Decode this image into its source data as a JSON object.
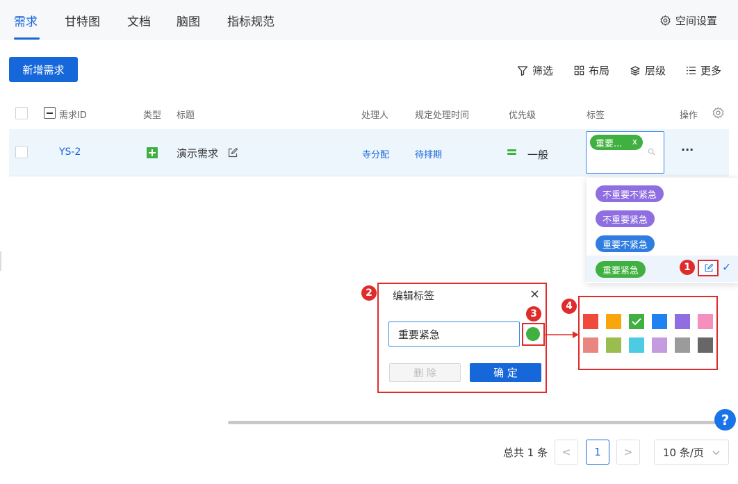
{
  "nav": {
    "tabs": [
      "需求",
      "甘特图",
      "文档",
      "脑图",
      "指标规范"
    ],
    "settings_label": "空间设置",
    "settings_icon": "gear-icon"
  },
  "toolbar": {
    "add_label": "新增需求",
    "filter_label": "筛选",
    "layout_label": "布局",
    "level_label": "层级",
    "more_label": "更多"
  },
  "table": {
    "headers": {
      "id": "需求ID",
      "type": "类型",
      "title": "标题",
      "assignee": "处理人",
      "due": "规定处理时间",
      "priority": "优先级",
      "tags": "标签",
      "actions": "操作"
    },
    "row": {
      "id": "YS-2",
      "title": "演示需求",
      "assignee": "寺分配",
      "due": "待排期",
      "priority": "一般",
      "tag": "重要...",
      "tag_remove": "x",
      "actions": "···"
    }
  },
  "tag_dropdown": {
    "options": [
      {
        "label": "不重要不紧急",
        "color": "#8e6ee0"
      },
      {
        "label": "不重要紧急",
        "color": "#8e6ee0"
      },
      {
        "label": "重要不紧急",
        "color": "#2f7de1"
      },
      {
        "label": "重要紧急",
        "color": "#40b141",
        "selected": true
      }
    ],
    "check_mark": "✓"
  },
  "annotations": [
    "1",
    "2",
    "3",
    "4"
  ],
  "edit_dialog": {
    "title": "编辑标签",
    "close": "×",
    "name_value": "重要紧急",
    "selected_color": "#40b141",
    "delete_label": "删 除",
    "confirm_label": "确 定"
  },
  "palette": {
    "colors": [
      "#f04a3c",
      "#f9a50c",
      "#40b141",
      "#1e82f0",
      "#8e6ee0",
      "#f58fbd",
      "#ea8680",
      "#9bbd50",
      "#4ccbe5",
      "#c49bdf",
      "#9b9b9b",
      "#676767"
    ],
    "selected": "#40b141"
  },
  "pagination": {
    "total": "总共 1 条",
    "prev": "<",
    "current": "1",
    "next": ">",
    "page_size": "10 条/页"
  },
  "help": "?"
}
